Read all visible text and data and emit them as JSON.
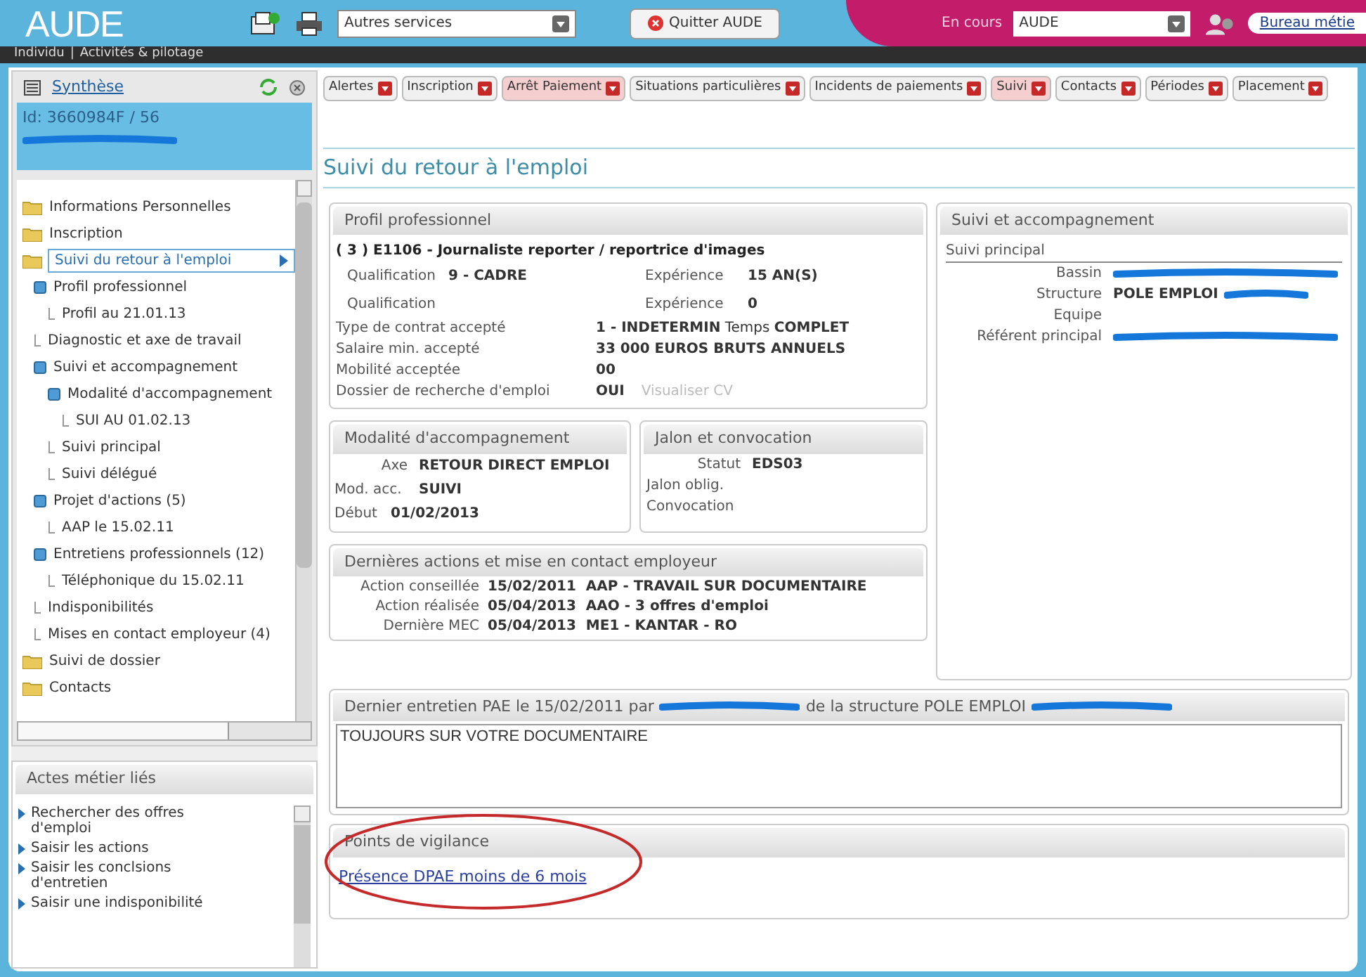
{
  "header": {
    "logo": "AUDE",
    "services_select": {
      "value": "Autres services"
    },
    "quit_button": "Quitter AUDE",
    "current": {
      "label": "En cours",
      "value": "AUDE"
    },
    "office_link": "Bureau métie"
  },
  "nav": {
    "items": [
      "Individu",
      "Activités & pilotage"
    ],
    "separator": "|"
  },
  "sidebar": {
    "title": "Synthèse",
    "id": "Id: 3660984F / 56",
    "tree": [
      {
        "label": "Informations Personnelles",
        "selected": false
      },
      {
        "label": "Inscription",
        "selected": false
      },
      {
        "label": "Suivi du retour à l'emploi",
        "selected": true,
        "children": [
          {
            "label": "Profil professionnel",
            "selected": false,
            "children": [
              {
                "label": "Profil au 21.01.13",
                "selected": false
              }
            ]
          },
          {
            "label": "Diagnostic et axe de travail",
            "selected": false
          },
          {
            "label": "Suivi et accompagnement",
            "selected": false,
            "children": [
              {
                "label": "Modalité d'accompagnement",
                "selected": false,
                "children": [
                  {
                    "label": "SUI AU 01.02.13",
                    "selected": false
                  }
                ]
              },
              {
                "label": "Suivi principal",
                "selected": false
              },
              {
                "label": "Suivi délégué",
                "selected": false
              }
            ]
          },
          {
            "label": "Projet d'actions (5)",
            "selected": false,
            "children": [
              {
                "label": "AAP le 15.02.11",
                "selected": false
              }
            ]
          },
          {
            "label": "Entretiens professionnels (12)",
            "selected": false,
            "children": [
              {
                "label": "Téléphonique du 15.02.11",
                "selected": false
              }
            ]
          },
          {
            "label": "Indisponibilités",
            "selected": false
          },
          {
            "label": "Mises en contact employeur (4)",
            "selected": false
          }
        ]
      },
      {
        "label": "Suivi de dossier",
        "selected": false
      },
      {
        "label": "Contacts",
        "selected": false
      }
    ],
    "actions": {
      "title": "Actes métier liés",
      "items": [
        "Rechercher des offres d'emploi",
        "Saisir les actions",
        "Saisir les conclsions d'entretien",
        "Saisir une indisponibilité"
      ]
    }
  },
  "tabs": [
    {
      "label": "Alertes",
      "highlighted": false
    },
    {
      "label": "Inscription",
      "highlighted": false
    },
    {
      "label": "Arrêt Paiement",
      "highlighted": true
    },
    {
      "label": "Situations particulières",
      "highlighted": false
    },
    {
      "label": "Incidents de paiements",
      "highlighted": false
    },
    {
      "label": "Suivi",
      "highlighted": true
    },
    {
      "label": "Contacts",
      "highlighted": false
    },
    {
      "label": "Périodes",
      "highlighted": false
    },
    {
      "label": "Placement",
      "highlighted": false
    }
  ],
  "page_title": "Suivi du retour à l'emploi",
  "profil": {
    "title": "Profil professionnel",
    "job": "( 3 ) E1106 - Journaliste reporter / reportrice d'images",
    "pairs": [
      {
        "label": "Qualification",
        "value": "9 - CADRE",
        "label2": "Expérience",
        "value2": "15 AN(S)"
      },
      {
        "label": "Qualification",
        "label2": "Expérience",
        "value2": "0"
      }
    ],
    "rows": [
      {
        "label": "Type de contrat accepté",
        "value": "**1 - INDETERMIN** Temps **COMPLET**"
      },
      {
        "label": "Salaire min. accepté",
        "value": "**33 000 EUROS BRUTS ANNUELS**"
      },
      {
        "label": "Mobilité acceptée",
        "value": "**00**"
      },
      {
        "label": "Dossier de recherche d'emploi",
        "value": "**OUI**",
        "link": {
          "text": "Visualiser CV",
          "disabled": true
        }
      }
    ]
  },
  "modalite": {
    "title": "Modalité d'accompagnement",
    "rows": [
      {
        "label": "Axe",
        "value": "RETOUR DIRECT EMPLOI"
      },
      {
        "label": "Mod. acc.",
        "value": "SUIVI"
      },
      {
        "label": "Début",
        "value": "01/02/2013"
      }
    ]
  },
  "jalon": {
    "title": "Jalon et convocation",
    "rows": [
      {
        "label": "Statut",
        "value": "EDS03"
      },
      {
        "label": "Jalon oblig."
      },
      {
        "label": "Convocation"
      }
    ]
  },
  "dernieres": {
    "title": "Dernières actions et mise en contact employeur",
    "rows": [
      {
        "label": "Action conseillée",
        "value": "15/02/2011  AAP - TRAVAIL SUR DOCUMENTAIRE"
      },
      {
        "label": "Action réalisée",
        "value": "05/04/2013  AAO - 3 offres d'emploi"
      },
      {
        "label": "Dernière MEC",
        "value": "05/04/2013  ME1 - KANTAR - RO"
      }
    ]
  },
  "suivi": {
    "title": "Suivi et accompagnement",
    "subtitle": "Suivi principal",
    "rows": [
      {
        "label": "Bassin",
        "redacted": true
      },
      {
        "label": "Structure",
        "value": "POLE EMPLOI",
        "redacted": true
      },
      {
        "label": "Equipe",
        "redacted": false
      },
      {
        "label": "Référent principal",
        "redacted": true
      }
    ]
  },
  "entretien": {
    "title_parts": [
      "Dernier entretien PAE le 15/02/2011 par",
      "de la structure POLE EMPLOI"
    ],
    "text": "TOUJOURS SUR VOTRE DOCUMENTAIRE"
  },
  "vigilance": {
    "title": "Points de vigilance",
    "link": "Présence DPAE moins de 6 mois",
    "circled": true
  }
}
